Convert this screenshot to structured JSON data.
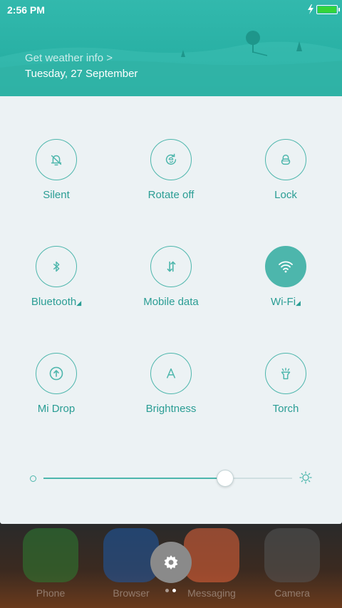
{
  "status_bar": {
    "time": "2:56 PM"
  },
  "header": {
    "weather_link": "Get weather info >",
    "date": "Tuesday, 27 September"
  },
  "toggles": [
    {
      "label": "Silent",
      "icon": "bell-off-icon",
      "active": false,
      "has_arrow": false
    },
    {
      "label": "Rotate off",
      "icon": "rotate-lock-icon",
      "active": false,
      "has_arrow": false
    },
    {
      "label": "Lock",
      "icon": "lock-icon",
      "active": false,
      "has_arrow": false
    },
    {
      "label": "Bluetooth",
      "icon": "bluetooth-icon",
      "active": false,
      "has_arrow": true
    },
    {
      "label": "Mobile data",
      "icon": "mobile-data-icon",
      "active": false,
      "has_arrow": false
    },
    {
      "label": "Wi-Fi",
      "icon": "wifi-icon",
      "active": true,
      "has_arrow": true
    },
    {
      "label": "Mi Drop",
      "icon": "mi-drop-icon",
      "active": false,
      "has_arrow": false
    },
    {
      "label": "Brightness",
      "icon": "brightness-auto-icon",
      "active": false,
      "has_arrow": false
    },
    {
      "label": "Torch",
      "icon": "torch-icon",
      "active": false,
      "has_arrow": false
    }
  ],
  "brightness_slider": {
    "value_fraction": 0.73
  },
  "dock": {
    "apps": [
      {
        "label": "Phone",
        "color": "#2e7d32"
      },
      {
        "label": "Browser",
        "color": "#1e5aa8"
      },
      {
        "label": "Messaging",
        "color": "#e8643a"
      },
      {
        "label": "Camera",
        "color": "#555555"
      }
    ]
  },
  "colors": {
    "accent": "#4db6ac",
    "header": "#2ab3a7",
    "panel": "#ecf2f4"
  }
}
